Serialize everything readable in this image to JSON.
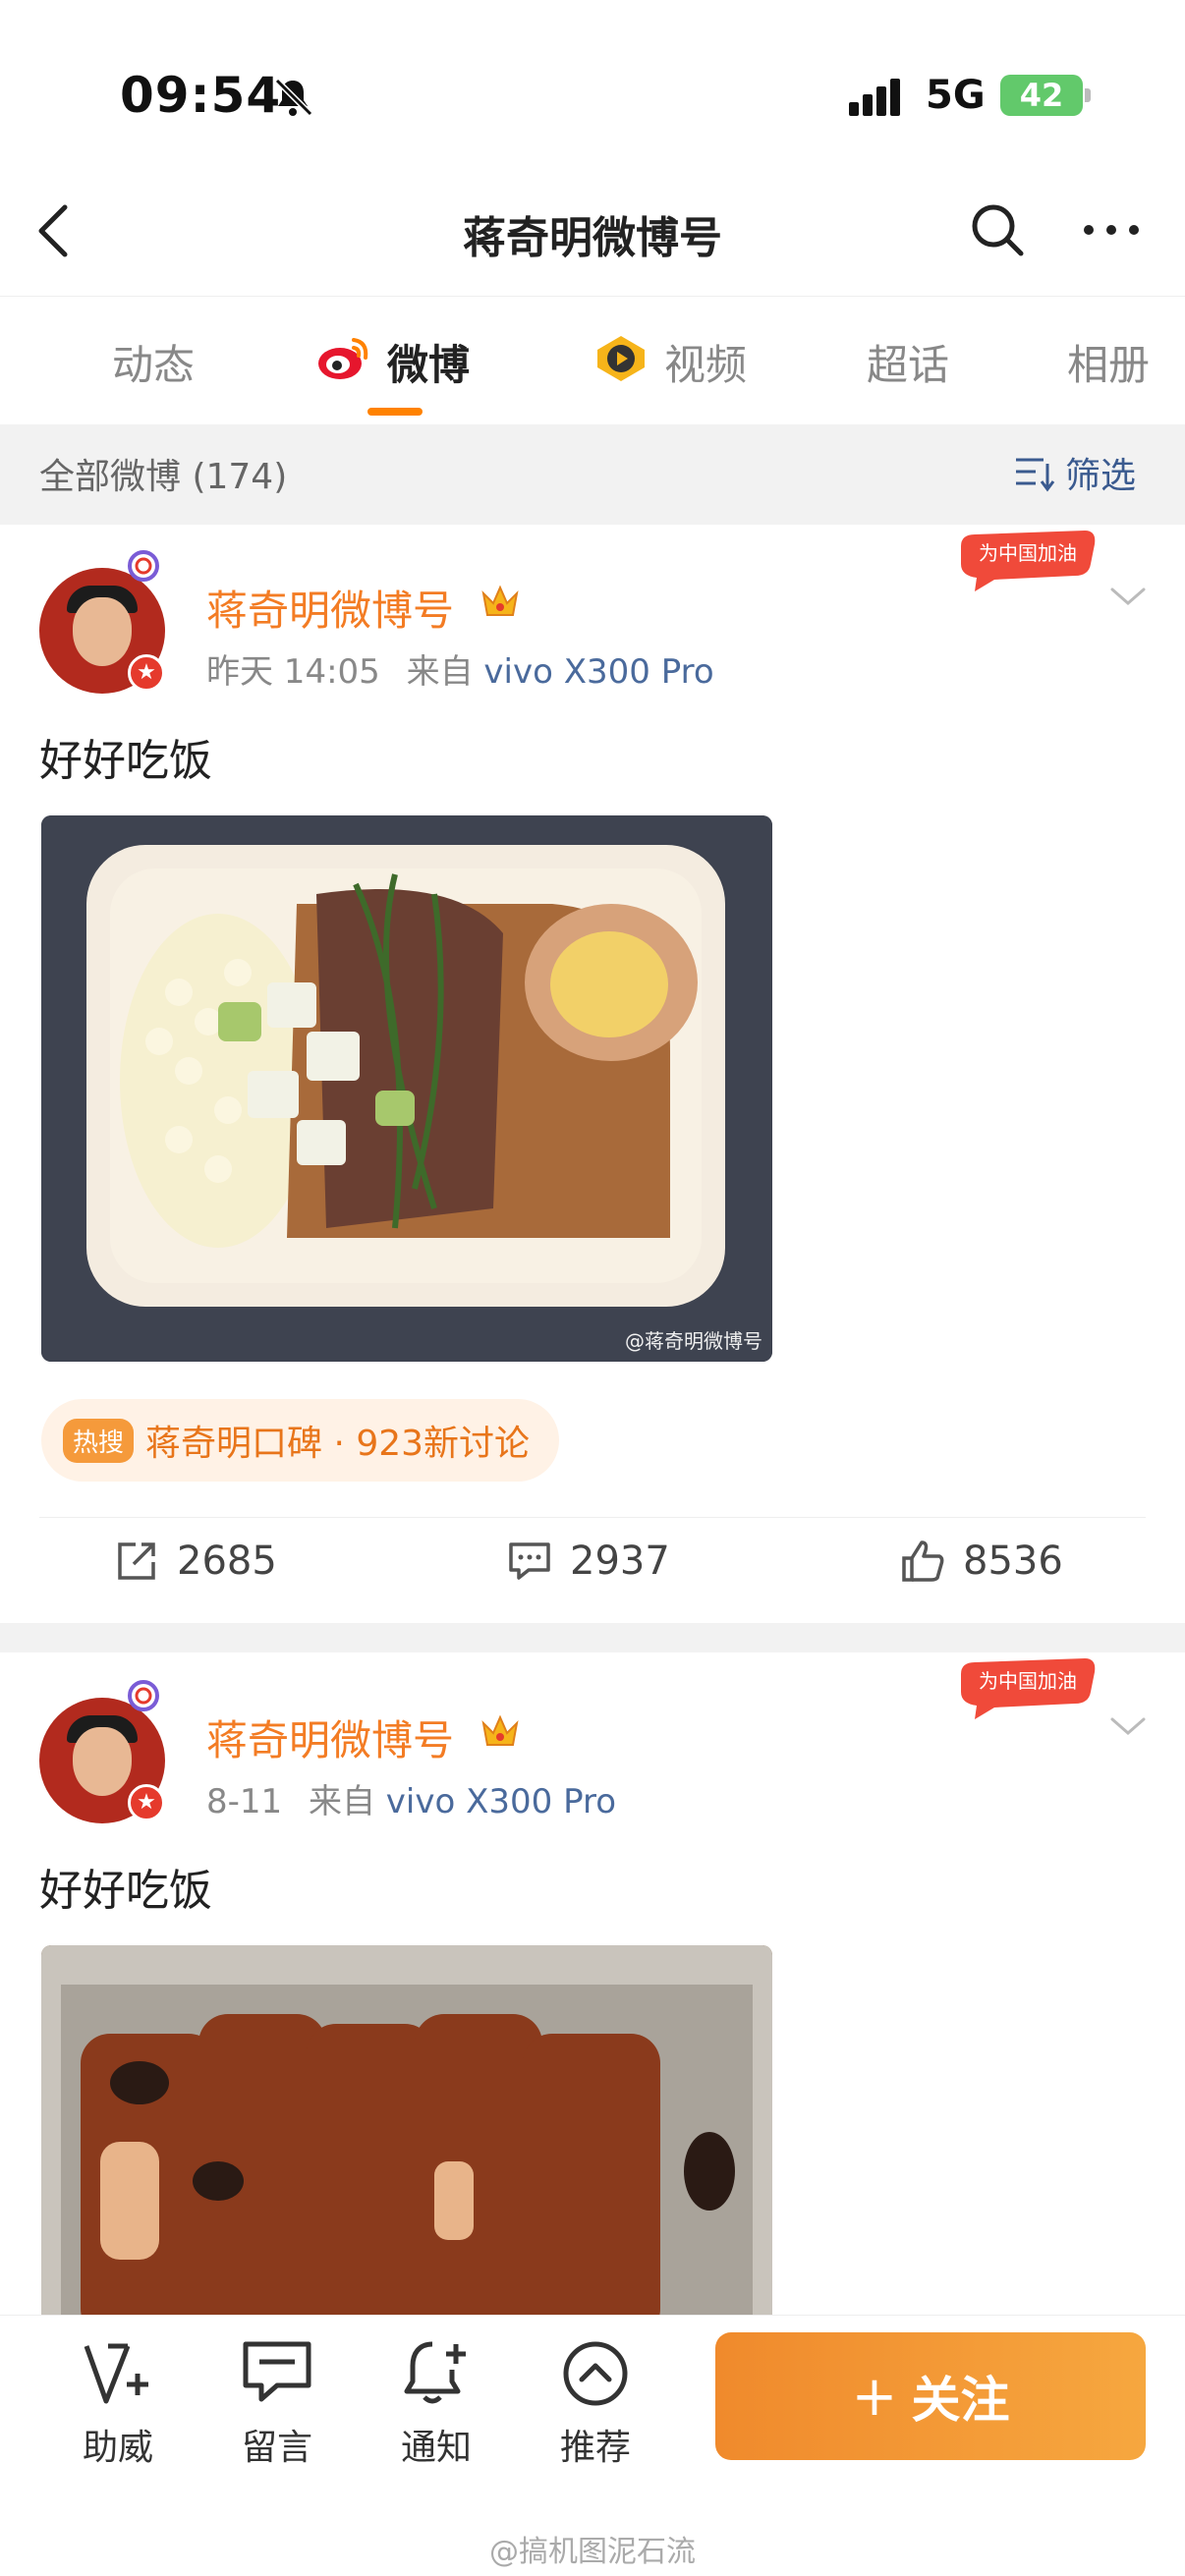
{
  "status_bar": {
    "time": "09:54",
    "network": "5G",
    "battery": "42"
  },
  "nav": {
    "title": "蒋奇明微博号"
  },
  "tabs": [
    {
      "label": "动态"
    },
    {
      "label": "微博"
    },
    {
      "label": "视频"
    },
    {
      "label": "超话"
    },
    {
      "label": "相册"
    }
  ],
  "filter": {
    "label": "全部微博 (174)",
    "button": "筛选"
  },
  "posts": [
    {
      "username": "蒋奇明微博号",
      "time": "昨天 14:05",
      "source_prefix": "来自",
      "source": "vivo X300 Pro",
      "text": "好好吃饭",
      "watermark": "@蒋奇明微博号",
      "promo": "为中国加油",
      "hot_badge": "热搜",
      "hot_text": "蒋奇明口碑 · 923新讨论",
      "reposts": "2685",
      "comments": "2937",
      "likes": "8536"
    },
    {
      "username": "蒋奇明微博号",
      "time": "8-11",
      "source_prefix": "来自",
      "source": "vivo X300 Pro",
      "text": "好好吃饭",
      "promo": "为中国加油"
    }
  ],
  "bottom_bar": {
    "items": [
      {
        "label": "助威"
      },
      {
        "label": "留言"
      },
      {
        "label": "通知"
      },
      {
        "label": "推荐"
      }
    ],
    "follow": "关注",
    "follow_plus": "+"
  },
  "page_watermark": "@搞机图泥石流",
  "colors": {
    "accent": "#ff8200",
    "username": "#f37c24",
    "link": "#4a6a9c",
    "follow_button": "#f08a2c"
  }
}
